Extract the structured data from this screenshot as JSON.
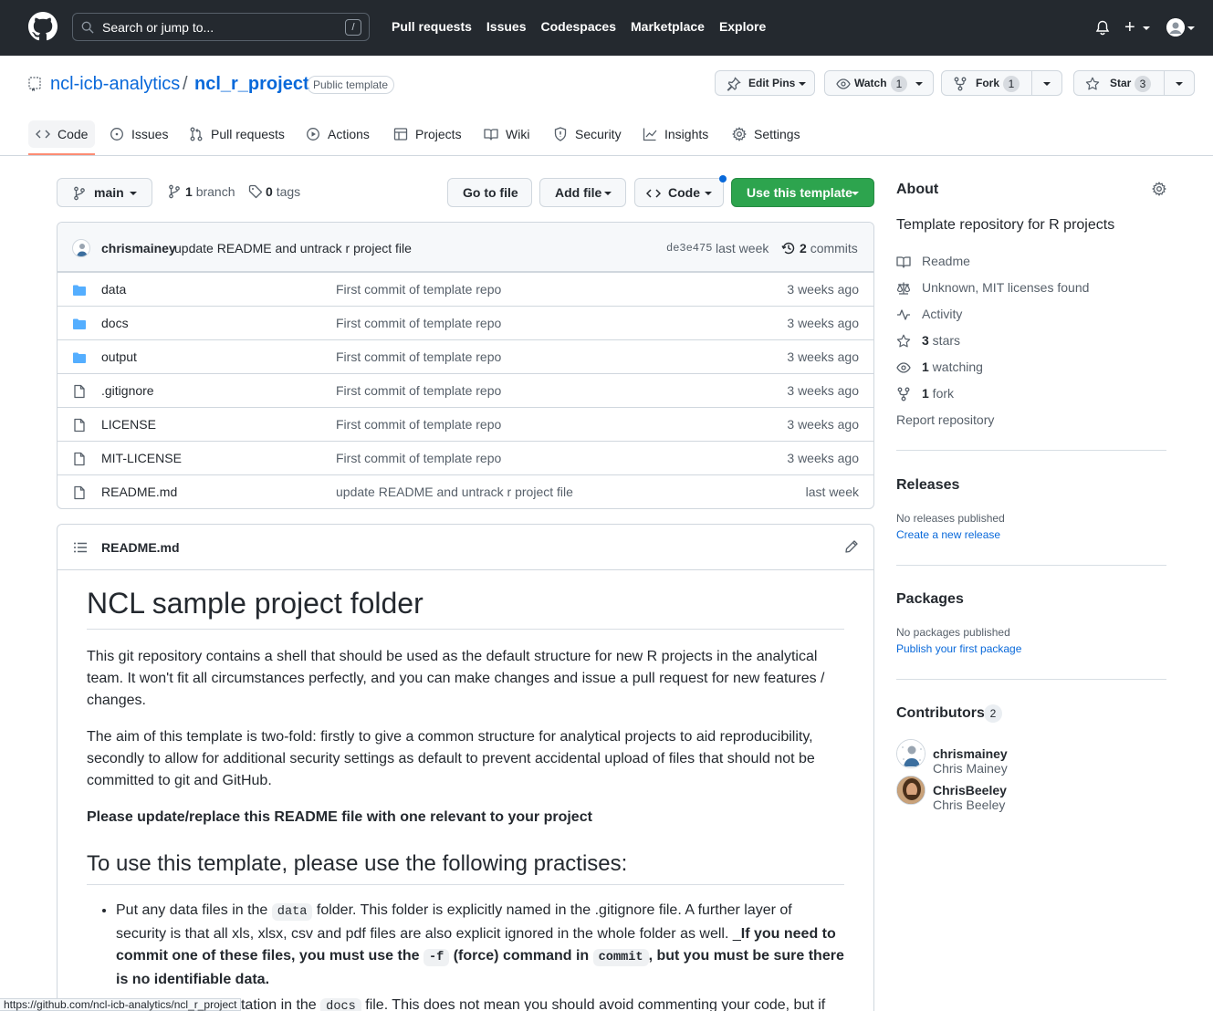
{
  "header": {
    "search_placeholder": "Search or jump to...",
    "search_key": "/",
    "nav": [
      "Pull requests",
      "Issues",
      "Codespaces",
      "Marketplace",
      "Explore"
    ],
    "plus": "+"
  },
  "repo": {
    "owner": "ncl-icb-analytics",
    "separator": "/",
    "name": "ncl_r_project",
    "visibility": "Public template",
    "edit_pins": "Edit Pins",
    "watch": "Watch",
    "watch_count": "1",
    "fork": "Fork",
    "fork_count": "1",
    "star": "Star",
    "star_count": "3"
  },
  "tabs": [
    {
      "label": "Code",
      "icon": "code-icon"
    },
    {
      "label": "Issues",
      "icon": "issue-icon"
    },
    {
      "label": "Pull requests",
      "icon": "pull-request-icon"
    },
    {
      "label": "Actions",
      "icon": "play-icon"
    },
    {
      "label": "Projects",
      "icon": "table-icon"
    },
    {
      "label": "Wiki",
      "icon": "book-icon"
    },
    {
      "label": "Security",
      "icon": "shield-icon"
    },
    {
      "label": "Insights",
      "icon": "graph-icon"
    },
    {
      "label": "Settings",
      "icon": "gear-icon"
    }
  ],
  "branchbar": {
    "branch": "main",
    "branch_count": "1",
    "branch_word": "branch",
    "tag_count": "0",
    "tag_word": "tags",
    "go_to_file": "Go to file",
    "add_file": "Add file",
    "code": "Code",
    "use_template": "Use this template"
  },
  "last_commit": {
    "author": "chrismainey",
    "message": "update README and untrack r project file",
    "sha": "de3e475",
    "time": "last week",
    "commit_count": "2",
    "commit_word": "commits"
  },
  "files": [
    {
      "type": "folder",
      "name": "data",
      "message": "First commit of template repo",
      "time": "3 weeks ago"
    },
    {
      "type": "folder",
      "name": "docs",
      "message": "First commit of template repo",
      "time": "3 weeks ago"
    },
    {
      "type": "folder",
      "name": "output",
      "message": "First commit of template repo",
      "time": "3 weeks ago"
    },
    {
      "type": "file",
      "name": ".gitignore",
      "message": "First commit of template repo",
      "time": "3 weeks ago"
    },
    {
      "type": "file",
      "name": "LICENSE",
      "message": "First commit of template repo",
      "time": "3 weeks ago"
    },
    {
      "type": "file",
      "name": "MIT-LICENSE",
      "message": "First commit of template repo",
      "time": "3 weeks ago"
    },
    {
      "type": "file",
      "name": "README.md",
      "message": "update README and untrack r project file",
      "time": "last week"
    }
  ],
  "readme": {
    "file_name": "README.md",
    "h1": "NCL sample project folder",
    "p1": "This git repository contains a shell that should be used as the default structure for new R projects in the analytical team. It won't fit all circumstances perfectly, and you can make changes and issue a pull request for new features / changes.",
    "p2": "The aim of this template is two-fold: firstly to give a common structure for analytical projects to aid reproducibility, secondly to allow for additional security settings as default to prevent accidental upload of files that should not be committed to git and GitHub.",
    "p3": "Please update/replace this README file with one relevant to your project",
    "h2": "To use this template, please use the following practises:",
    "li1_a": "Put any data files in the ",
    "li1_code1": "data",
    "li1_b": " folder. This folder is explicitly named in the .gitignore file. A further layer of security is that all xls, xlsx, csv and pdf files are also explicit ignored in the whole folder as well. _",
    "li1_c": "If you need to commit one of these files, you must use the ",
    "li1_code2": "-f",
    "li1_d": " (force) command in ",
    "li1_code3": "commit",
    "li1_e": ", but you must be sure there is no identifiable data.",
    "li2_a": "Save any documentation in the ",
    "li2_code": "docs",
    "li2_b": " file. This does not mean you should avoid commenting your code, but if"
  },
  "sidebar": {
    "about_title": "About",
    "description": "Template repository for R projects",
    "items": [
      {
        "icon": "book-icon",
        "bold": "",
        "text": "Readme"
      },
      {
        "icon": "law-icon",
        "bold": "",
        "text": "Unknown, MIT licenses found"
      },
      {
        "icon": "pulse-icon",
        "bold": "",
        "text": "Activity"
      },
      {
        "icon": "star-icon",
        "bold": "3",
        "text": " stars"
      },
      {
        "icon": "eye-icon",
        "bold": "1",
        "text": " watching"
      },
      {
        "icon": "fork-icon",
        "bold": "1",
        "text": " fork"
      }
    ],
    "report": "Report repository",
    "releases_title": "Releases",
    "releases_empty": "No releases published",
    "releases_link": "Create a new release",
    "packages_title": "Packages",
    "packages_empty": "No packages published",
    "packages_link": "Publish your first package",
    "contributors_title": "Contributors",
    "contributors_count": "2",
    "contributors": [
      {
        "username": "chrismainey",
        "fullname": "Chris Mainey"
      },
      {
        "username": "ChrisBeeley",
        "fullname": "Chris Beeley"
      }
    ]
  },
  "statusbar": "https://github.com/ncl-icb-analytics/ncl_r_project",
  "colors": {
    "accent": "#0969da",
    "green": "#2da44e",
    "header_bg": "#24292f",
    "tab_underline": "#fd8c73",
    "folder": "#54aeff"
  }
}
